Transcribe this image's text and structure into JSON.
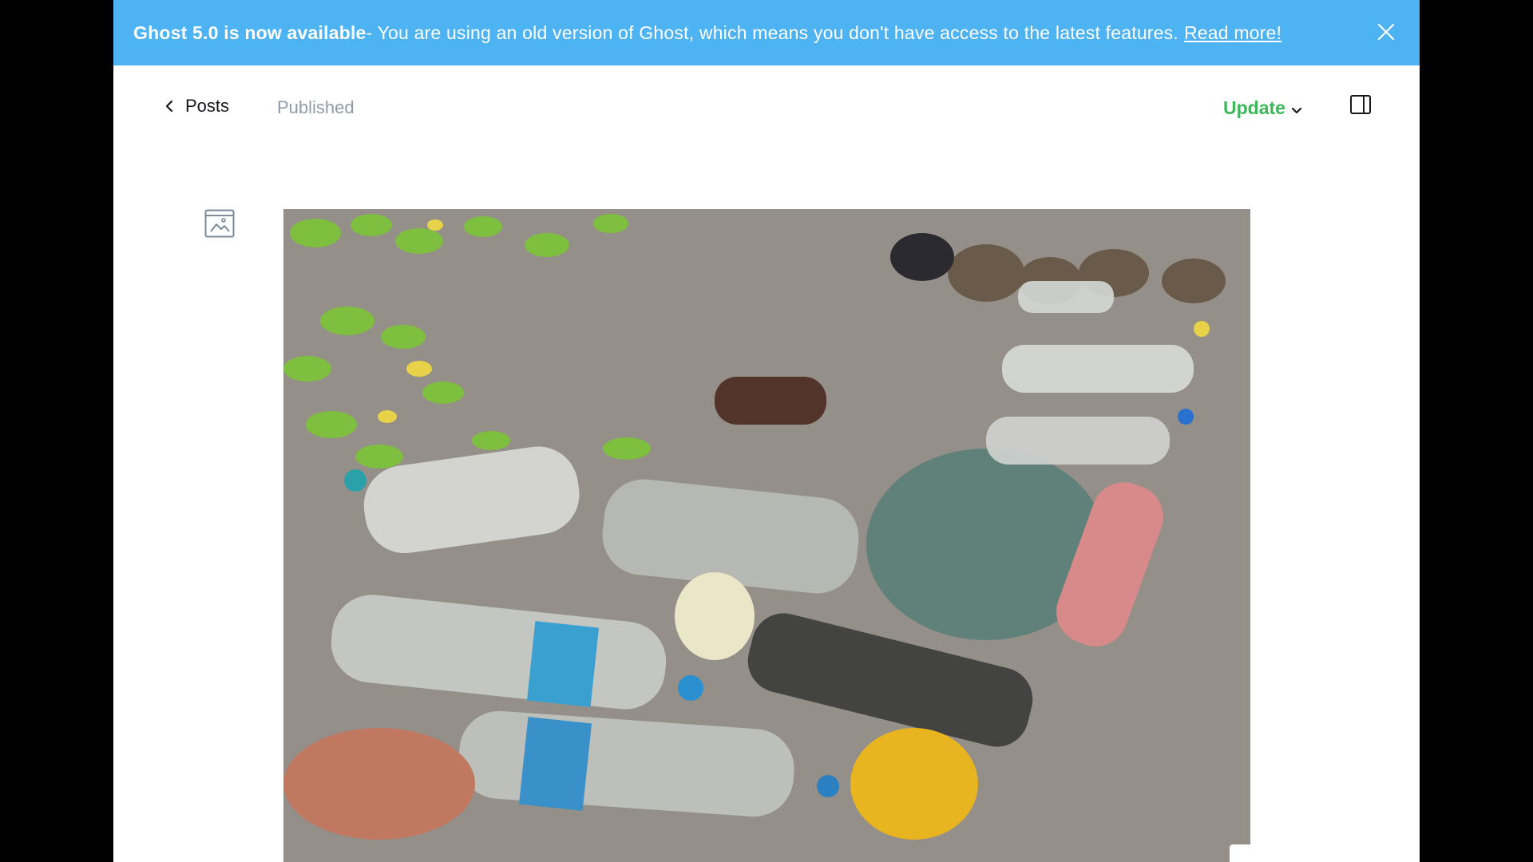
{
  "banner": {
    "strong_text": "Ghost 5.0 is now available",
    "message": " - You are using an old version of Ghost, which means you don't have access to the latest features.",
    "link_text": "Read more!",
    "close_icon": "close-icon",
    "background_color": "#4db3f2"
  },
  "header": {
    "back_label": "Posts",
    "back_icon": "chevron-left-icon",
    "status": "Published",
    "update_label": "Update",
    "update_icon": "chevron-down-icon",
    "sidebar_icon": "sidebar-toggle-icon",
    "accent_color": "#3eb75a"
  },
  "editor": {
    "feature_image_icon": "image-icon",
    "feature_image_subject": "plastic bottles and debris on a beach"
  }
}
